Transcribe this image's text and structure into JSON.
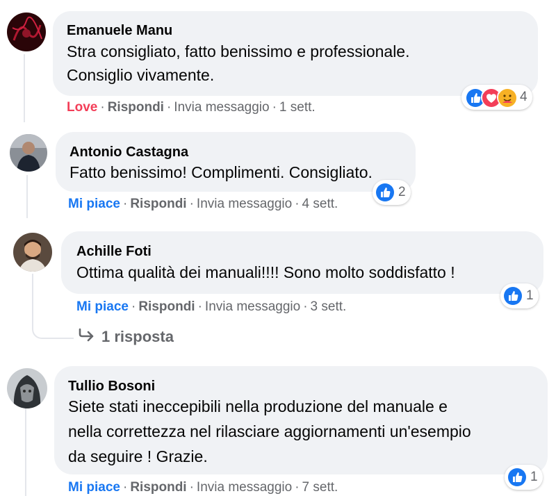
{
  "comments": [
    {
      "author": "Emanuele Manu",
      "lines": [
        "Stra consigliato, fatto benissimo e professionale.",
        "Consiglio vivamente."
      ],
      "reaction_label": "Love",
      "reply_label": "Rispondi",
      "message_label": "Invia messaggio",
      "time": "1 sett.",
      "reactions": {
        "icons": [
          "like-reaction",
          "love-reaction",
          "care-reaction"
        ],
        "count": "4"
      },
      "avatar_color": "#7a1020"
    },
    {
      "author": "Antonio Castagna",
      "lines": [
        "Fatto benissimo! Complimenti. Consigliato."
      ],
      "reaction_label": "Mi piace",
      "reply_label": "Rispondi",
      "message_label": "Invia messaggio",
      "time": "4 sett.",
      "reactions": {
        "icons": [
          "like-reaction"
        ],
        "count": "2"
      },
      "avatar_color": "#3a3f45"
    },
    {
      "author": "Achille Foti",
      "lines": [
        "Ottima qualità dei manuali!!!! Sono molto soddisfatto !"
      ],
      "reaction_label": "Mi piace",
      "reply_label": "Rispondi",
      "message_label": "Invia messaggio",
      "time": "3 sett.",
      "reactions": {
        "icons": [
          "like-reaction"
        ],
        "count": "1"
      },
      "replies_label": "1 risposta",
      "avatar_color": "#8a6a52"
    },
    {
      "author": "Tullio Bosoni",
      "lines": [
        "Siete stati ineccepibili nella produzione del manuale e",
        "nella correttezza nel rilasciare aggiornamenti un'esempio",
        "da seguire ! Grazie."
      ],
      "reaction_label": "Mi piace",
      "reply_label": "Rispondi",
      "message_label": "Invia messaggio",
      "time": "7 sett.",
      "reactions": {
        "icons": [
          "like-reaction"
        ],
        "count": "1"
      },
      "avatar_color": "#9aa0a6"
    }
  ],
  "colors": {
    "like": "#1877f2",
    "love": "#f33e58",
    "secondary_text": "#65676b",
    "bubble": "#f0f2f5"
  }
}
